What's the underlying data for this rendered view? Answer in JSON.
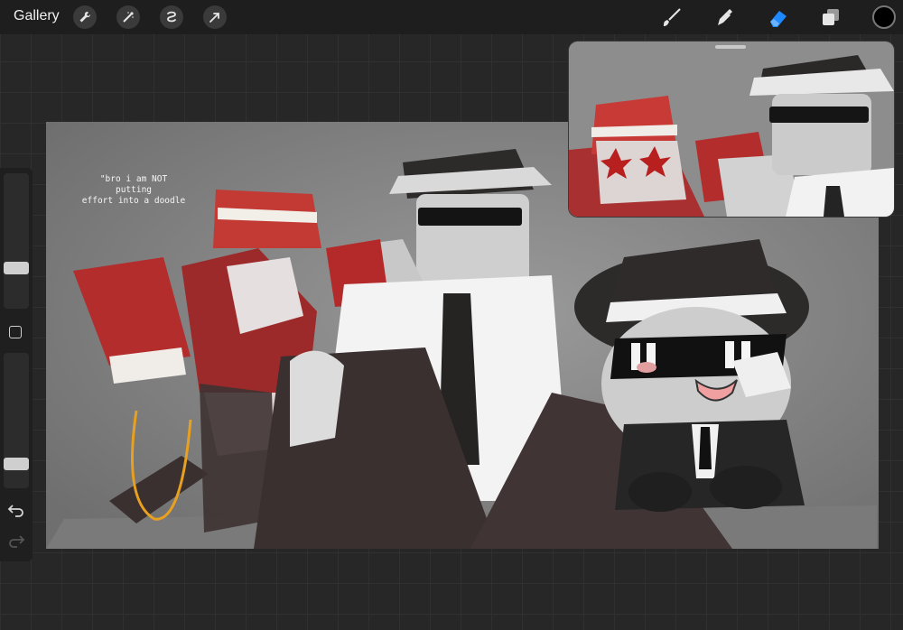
{
  "toolbar": {
    "gallery_label": "Gallery",
    "left_tools": [
      "wrench-icon",
      "magic-wand-icon",
      "selection-icon",
      "transform-arrow-icon"
    ],
    "right_tools": [
      "brush-icon",
      "smudge-icon",
      "eraser-icon",
      "layers-icon"
    ],
    "active_tool": "eraser-icon",
    "accent_color": "#1e88ff",
    "current_color": "#000000"
  },
  "sidebar": {
    "size_slider_level": 0.28,
    "opacity_slider_level": 0.15,
    "buttons": [
      "modify-button",
      "undo-icon",
      "redo-icon"
    ]
  },
  "canvas": {
    "caption_line1": "\"bro i am NOT putting",
    "caption_line2": "effort into a doodle",
    "background_color": "#8b8b8b"
  },
  "reference_window": {
    "visible": true
  }
}
